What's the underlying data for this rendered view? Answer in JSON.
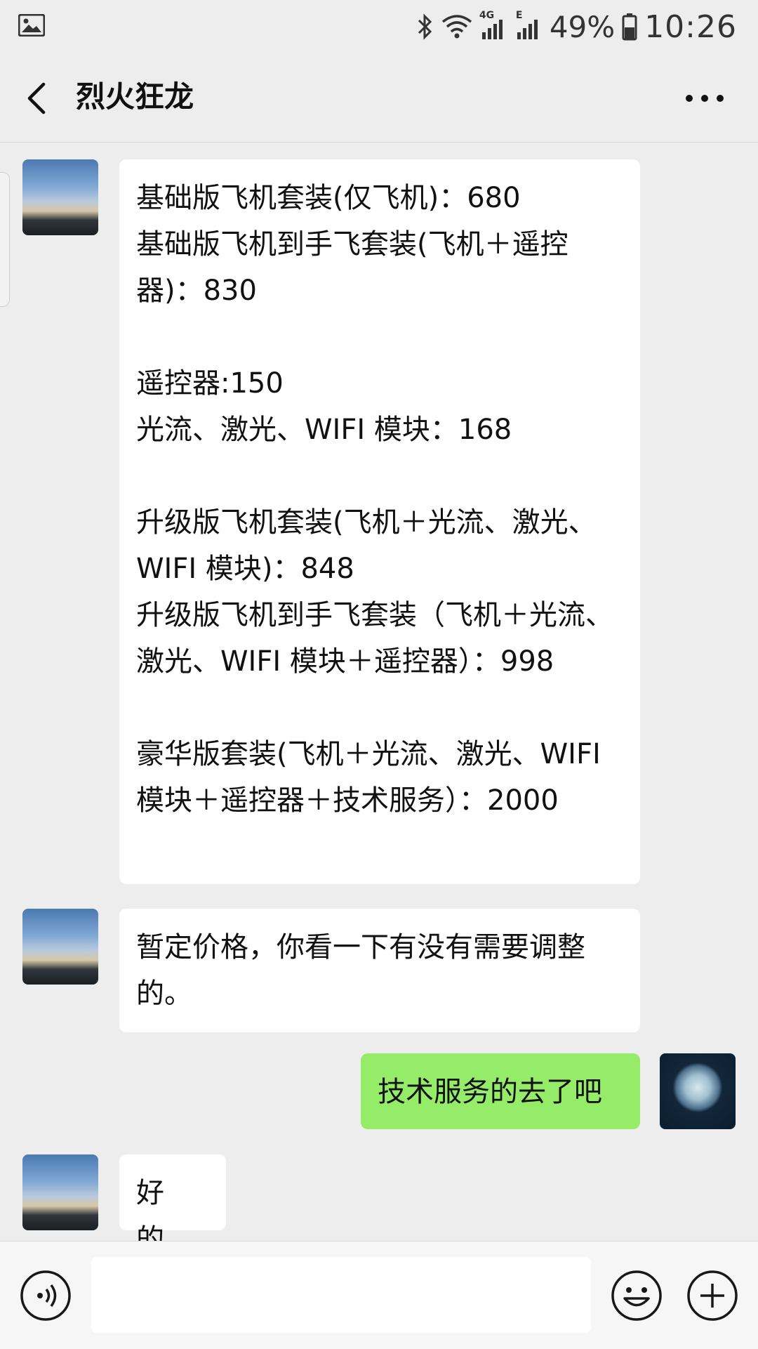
{
  "status_bar": {
    "battery": "49%",
    "time": "10:26",
    "network_4g": "4G",
    "network_e": "E"
  },
  "header": {
    "title": "烈火狂龙"
  },
  "messages": [
    {
      "side": "left",
      "text": "基础版飞机套装(仅飞机)：680\n基础版飞机到手飞套装(飞机＋遥控器)：830\n\n遥控器:150\n光流、激光、WIFI 模块：168\n\n升级版飞机套装(飞机＋光流、激光、WIFI 模块)：848\n升级版飞机到手飞套装（飞机＋光流、激光、WIFI 模块＋遥控器）：998\n\n豪华版套装(飞机＋光流、激光、WIFI 模块＋遥控器＋技术服务）：2000"
    },
    {
      "side": "left",
      "text": "暂定价格，你看一下有没有需要调整的。"
    },
    {
      "side": "right",
      "text": "技术服务的去了吧"
    },
    {
      "side": "left",
      "text": "好的。"
    }
  ],
  "input": {
    "value": "",
    "placeholder": ""
  },
  "colors": {
    "background": "#ededed",
    "bubble_left": "#ffffff",
    "bubble_right": "#95ec69"
  },
  "icons": {
    "gallery": "image-icon",
    "bluetooth": "bluetooth-icon",
    "wifi": "wifi-icon",
    "signal": "signal-icon",
    "battery": "battery-icon",
    "back": "chevron-left-icon",
    "more": "more-dots-icon",
    "voice": "voice-icon",
    "emoji": "emoji-icon",
    "plus": "plus-icon"
  }
}
